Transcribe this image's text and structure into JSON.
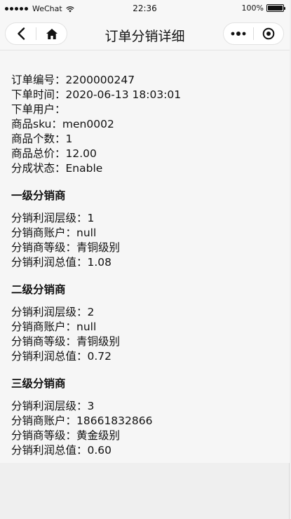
{
  "status_bar": {
    "carrier": "WeChat",
    "time": "22:36",
    "battery": "100%"
  },
  "nav": {
    "title": "订单分销详细",
    "back_icon": "back-chevron-icon",
    "home_icon": "home-icon",
    "more_icon": "more-dots-icon",
    "close_icon": "target-close-icon"
  },
  "order": {
    "order_no": "订单编号：2200000247",
    "order_time": "下单时间：2020-06-13 18:03:01",
    "order_user": "下单用户：",
    "sku": "商品sku：men0002",
    "count": "商品个数：1",
    "total": "商品总价：12.00",
    "status": "分成状态：Enable"
  },
  "levels": [
    {
      "title": "一级分销商",
      "tier": "分销利润层级：1",
      "account": "分销商账户：null",
      "grade": "分销商等级：青铜级别",
      "profit": "分销利润总值：1.08"
    },
    {
      "title": "二级分销商",
      "tier": "分销利润层级：2",
      "account": "分销商账户：null",
      "grade": "分销商等级：青铜级别",
      "profit": "分销利润总值：0.72"
    },
    {
      "title": "三级分销商",
      "tier": "分销利润层级：3",
      "account": "分销商账户：18661832866",
      "grade": "分销商等级：黄金级别",
      "profit": "分销利润总值：0.60"
    }
  ]
}
